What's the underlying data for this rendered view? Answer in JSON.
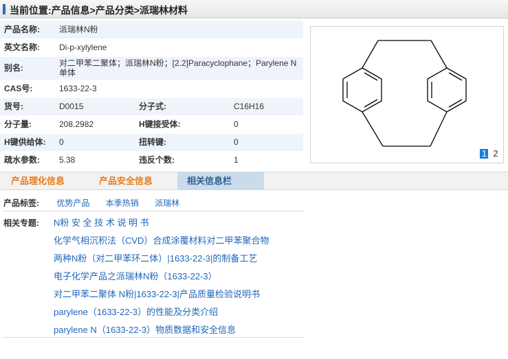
{
  "header": {
    "title": "当前位置:产品信息>产品分类>派瑞林材料"
  },
  "props": {
    "name_label": "产品名称:",
    "name": "派瑞林N粉",
    "en_label": "英文名称:",
    "en": "Di-p-xylylene",
    "alias_label": "别名:",
    "alias": "对二甲苯二聚体；派瑞林N粉；[2.2]Paracyclophane；Parylene N单体",
    "cas_label": "CAS号:",
    "cas": "1633-22-3",
    "code_label": "货号:",
    "code": "D0015",
    "formula_label": "分子式:",
    "formula": "C16H16",
    "mw_label": "分子量:",
    "mw": "208.2982",
    "hba_label": "H键接受体:",
    "hba": "0",
    "hbd_label": "H键供给体:",
    "hbd": "0",
    "rot_label": "扭转键:",
    "rot": "0",
    "logp_label": "疏水参数:",
    "logp": "5.38",
    "viol_label": "违反个数:",
    "viol": "1"
  },
  "image_pager": [
    "1",
    "2"
  ],
  "tabs": [
    "产品理化信息",
    "产品安全信息",
    "相关信息栏"
  ],
  "tags": {
    "label": "产品标签:",
    "items": [
      "优势产品",
      "本季热销",
      "派瑞林"
    ]
  },
  "topics": {
    "label": "相关专题:",
    "items": [
      "N粉 安 全 技 术 说 明 书",
      "化学气相沉积法（CVD）合成涂覆材料对二甲苯聚合物",
      "两种N粉（对二甲苯环二体）|1633-22-3|的制备工艺",
      "电子化学产品之派瑞林N粉（1633-22-3）",
      "对二甲苯二聚体 N粉|1633-22-3|产品质量检验说明书",
      "parylene（1633-22-3）的性能及分类介绍",
      "parylene N（1633-22-3）物质数据和安全信息"
    ]
  }
}
